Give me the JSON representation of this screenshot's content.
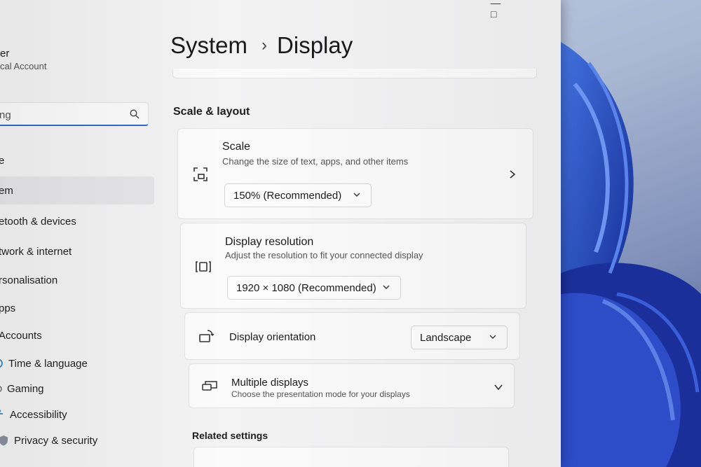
{
  "user": {
    "name": "er",
    "account": "cal Account"
  },
  "search": {
    "value": "ng"
  },
  "sidebar": {
    "items": [
      {
        "label": "e",
        "icon": "home-icon"
      },
      {
        "label": "em",
        "icon": "system-icon",
        "selected": true
      },
      {
        "label": "etooth & devices",
        "icon": "bluetooth-icon"
      },
      {
        "label": "twork & internet",
        "icon": "network-icon"
      },
      {
        "label": "rsonalisation",
        "icon": "brush-icon"
      },
      {
        "label": "pps",
        "icon": "apps-icon"
      },
      {
        "label": "Accounts",
        "icon": "person-icon"
      },
      {
        "label": "Time & language",
        "icon": "globe-clock-icon"
      },
      {
        "label": "Gaming",
        "icon": "controller-icon"
      },
      {
        "label": "Accessibility",
        "icon": "accessibility-icon"
      },
      {
        "label": "Privacy & security",
        "icon": "shield-icon"
      }
    ]
  },
  "breadcrumb": {
    "parent": "System",
    "separator": "›",
    "current": "Display"
  },
  "section": {
    "title": "Scale & layout"
  },
  "cards": {
    "scale": {
      "title": "Scale",
      "subtitle": "Change the size of text, apps, and other items",
      "value": "150% (Recommended)",
      "icon": "scale-icon"
    },
    "resolution": {
      "title": "Display resolution",
      "subtitle": "Adjust the resolution to fit your connected display",
      "value": "1920 × 1080 (Recommended)",
      "icon": "resolution-icon"
    },
    "orientation": {
      "title": "Display orientation",
      "value": "Landscape",
      "icon": "orientation-icon"
    },
    "multiple": {
      "title": "Multiple displays",
      "subtitle": "Choose the presentation mode for your displays",
      "icon": "multiple-displays-icon"
    }
  },
  "related": {
    "title": "Related settings"
  },
  "colors": {
    "accent": "#2f6cc6",
    "window": "#f3f3f4",
    "card": "#fbfbfb"
  }
}
